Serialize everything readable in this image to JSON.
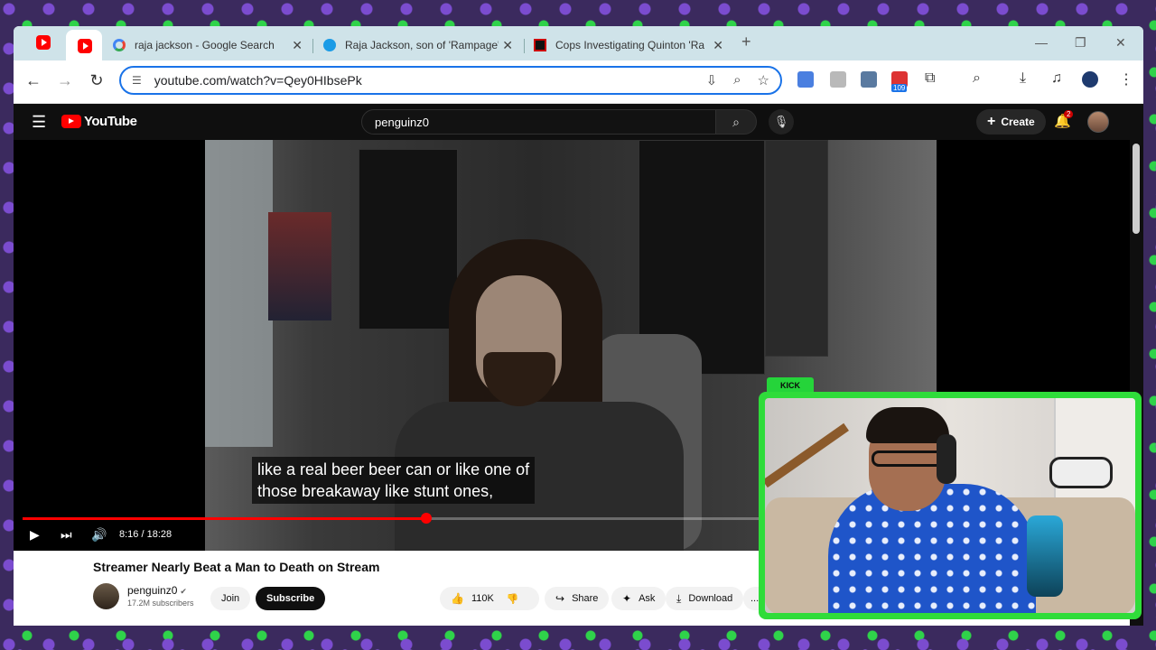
{
  "browser": {
    "tabs": [
      {
        "label": ""
      },
      {
        "label": "raja jackson - Google Search"
      },
      {
        "label": "Raja Jackson, son of 'Rampage'"
      },
      {
        "label": "Cops Investigating Quinton 'Ra"
      }
    ],
    "close_glyph": "✕",
    "new_tab_glyph": "+",
    "url": "youtube.com/watch?v=Qey0HIbsePk",
    "extension_badge": "109"
  },
  "youtube": {
    "logo_text": "YouTube",
    "search_value": "penguinz0",
    "create_label": "Create",
    "notification_count": "2",
    "video": {
      "caption_lines": [
        "like a real beer beer can or like one of",
        "those breakaway like stunt ones,"
      ],
      "time_display": "8:16 / 18:28",
      "progress_fraction": 0.447
    },
    "title": "Streamer Nearly Beat a Man to Death on Stream",
    "channel": {
      "name": "penguinz0",
      "subscribers": "17.2M subscribers"
    },
    "actions": {
      "join": "Join",
      "subscribe": "Subscribe",
      "likes": "110K",
      "share": "Share",
      "ask": "Ask",
      "download": "Download",
      "more": "..."
    }
  },
  "overlay": {
    "tag": "KICK"
  },
  "colors": {
    "accent_green": "#2fdc3a",
    "youtube_red": "#ff0000",
    "focus_blue": "#1a73e8"
  }
}
